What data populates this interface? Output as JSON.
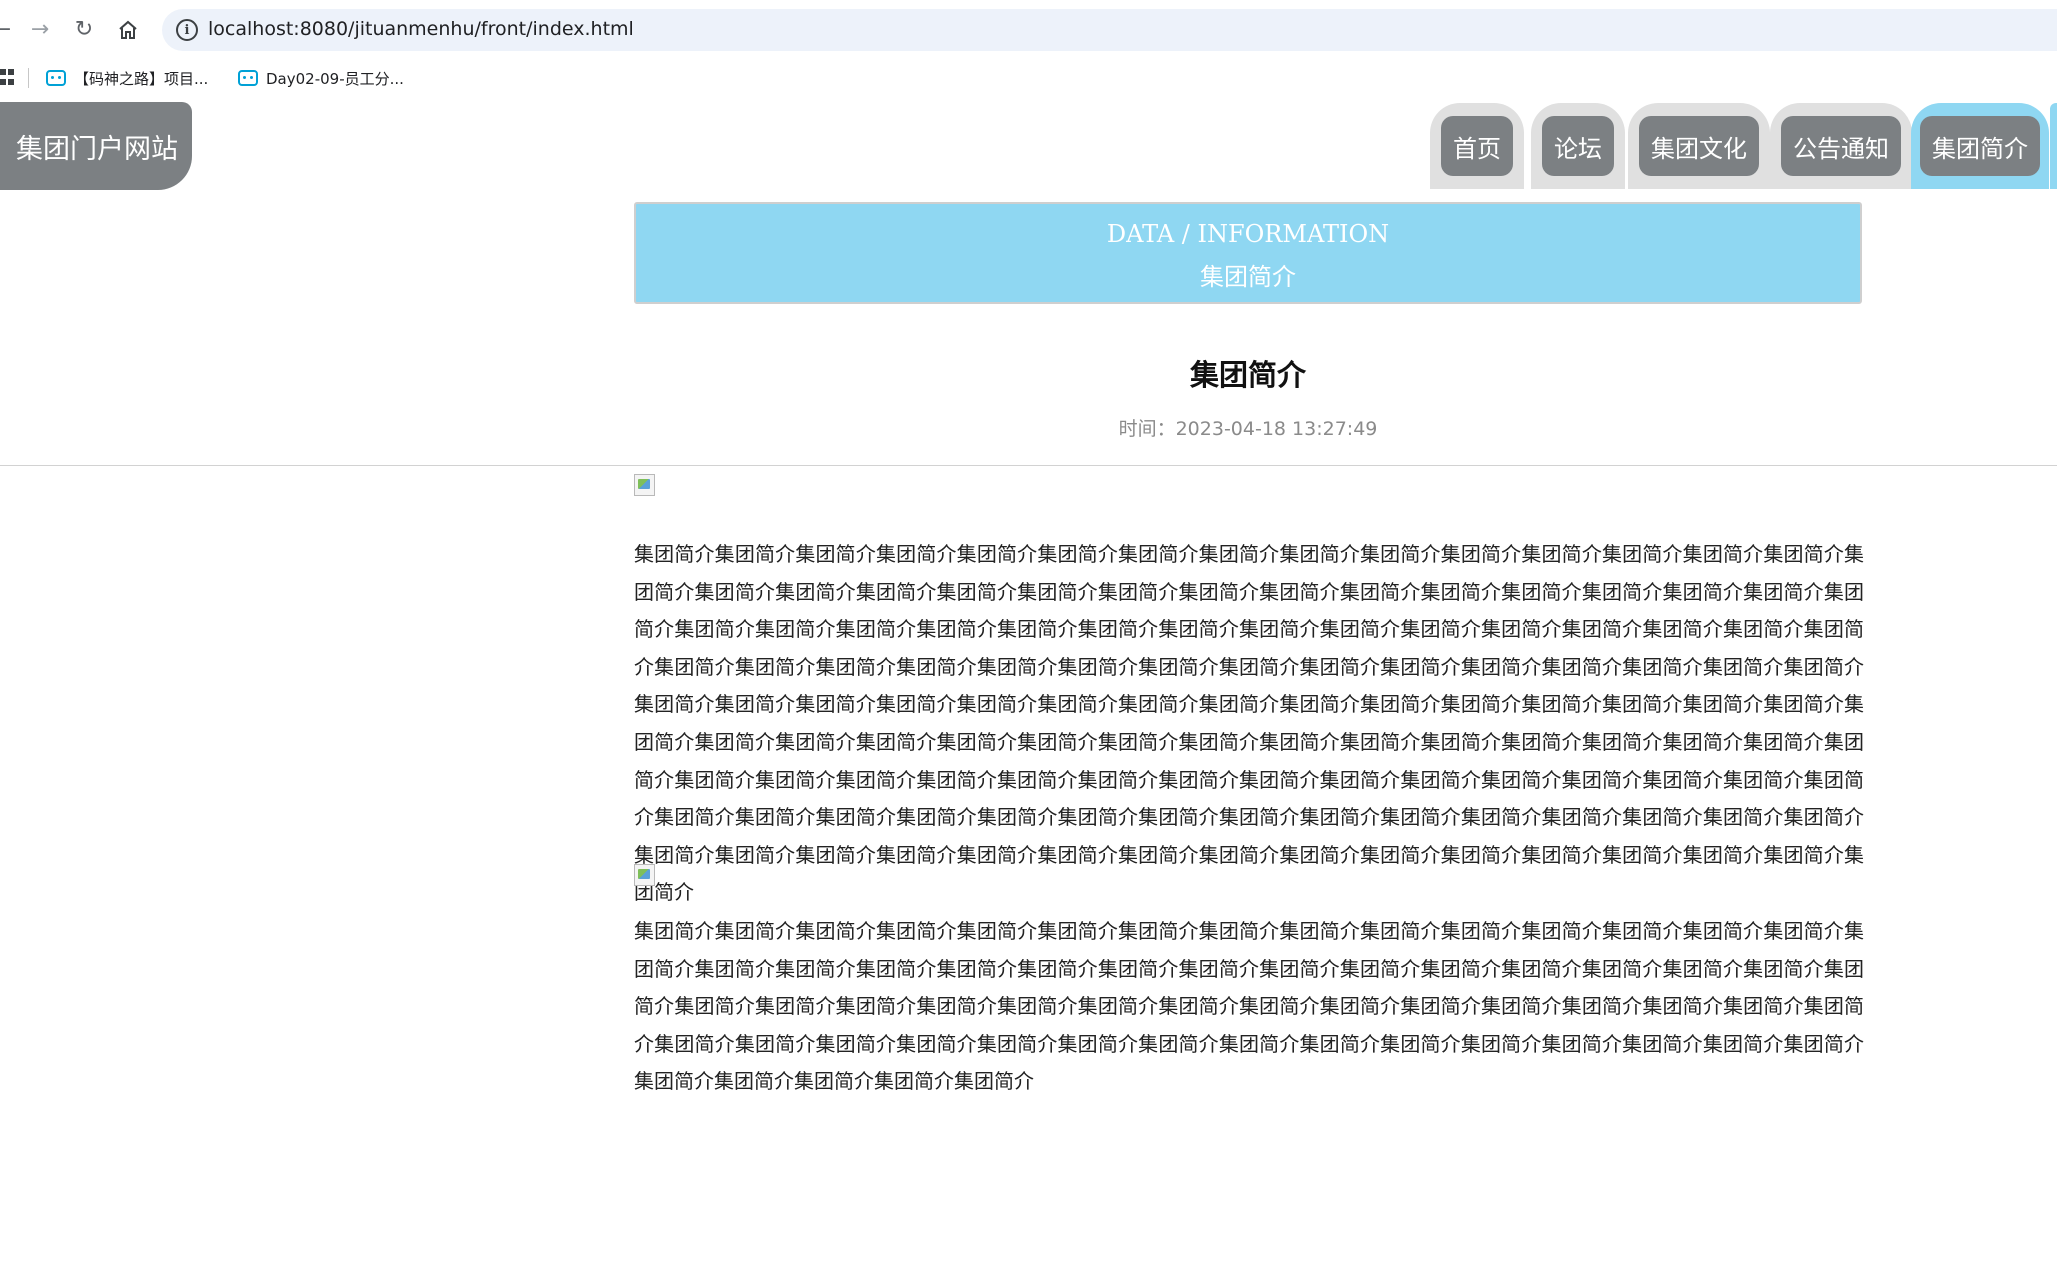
{
  "browser": {
    "url": "localhost:8080/jituanmenhu/front/index.html",
    "bookmarks": [
      {
        "label": "【码神之路】项目..."
      },
      {
        "label": "Day02-09-员工分..."
      }
    ]
  },
  "site": {
    "logo": "集团门户网站",
    "nav": [
      {
        "label": "首页"
      },
      {
        "label": "论坛"
      },
      {
        "label": "集团文化"
      },
      {
        "label": "公告通知"
      },
      {
        "label": "集团简介"
      }
    ],
    "active_nav": "集团简介"
  },
  "banner": {
    "en": "DATA / INFORMATION",
    "cn": "集团简介"
  },
  "article": {
    "title": "集团简介",
    "time": "时间：2023-04-18 13:27:49",
    "paragraph1": "集团简介集团简介集团简介集团简介集团简介集团简介集团简介集团简介集团简介集团简介集团简介集团简介集团简介集团简介集团简介集团简介集团简介集团简介集团简介集团简介集团简介集团简介集团简介集团简介集团简介集团简介集团简介集团简介集团简介集团简介集团简介集团简介集团简介集团简介集团简介集团简介集团简介集团简介集团简介集团简介集团简介集团简介集团简介集团简介集团简介集团简介集团简介集团简介集团简介集团简介集团简介集团简介集团简介集团简介集团简介集团简介集团简介集团简介集团简介集团简介集团简介集团简介集团简介集团简介集团简介集团简介集团简介集团简介集团简介集团简介集团简介集团简介集团简介集团简介集团简介集团简介集团简介集团简介集团简介集团简介集团简介集团简介集团简介集团简介集团简介集团简介集团简介集团简介集团简介集团简介集团简介集团简介集团简介集团简介集团简介集团简介集团简介集团简介集团简介集团简介集团简介集团简介集团简介集团简介集团简介集团简介集团简介集团简介集团简介集团简介集团简介集团简介集团简介集团简介集团简介集团简介集团简介集团简介集团简介集团简介集团简介集团简介集团简介集团简介集团简介集团简介集团简介集团简介集团简介集团简介集团简介集团简介集团简介集团简介集团简介集团简介集团简介集团简介",
    "paragraph2": "集团简介集团简介集团简介集团简介集团简介集团简介集团简介集团简介集团简介集团简介集团简介集团简介集团简介集团简介集团简介集团简介集团简介集团简介集团简介集团简介集团简介集团简介集团简介集团简介集团简介集团简介集团简介集团简介集团简介集团简介集团简介集团简介集团简介集团简介集团简介集团简介集团简介集团简介集团简介集团简介集团简介集团简介集团简介集团简介集团简介集团简介集团简介集团简介集团简介集团简介集团简介集团简介集团简介集团简介集团简介集团简介集团简介集团简介集团简介集团简介集团简介集团简介集团简介集团简介集团简介集团简介"
  },
  "icons": [
    "back-icon",
    "forward-icon",
    "reload-icon",
    "home-icon",
    "site-info-icon",
    "apps-icon",
    "bilibili-tv-icon",
    "broken-image-icon"
  ]
}
